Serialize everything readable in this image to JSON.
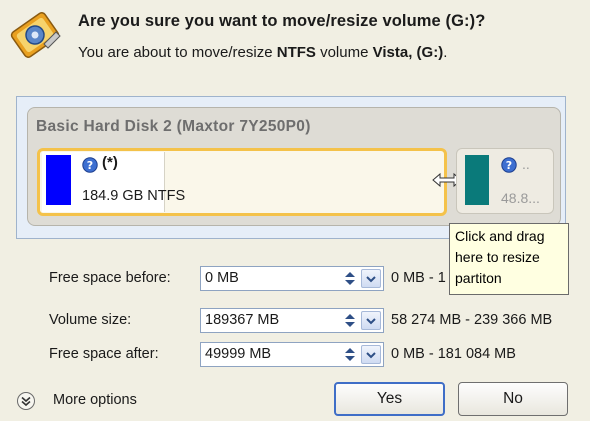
{
  "dialog": {
    "title": "Are you sure you want to move/resize volume (G:)?",
    "subtitle_prefix": "You are about to move/resize ",
    "subtitle_fs": "NTFS",
    "subtitle_mid": " volume ",
    "subtitle_volume": "Vista, (G:)",
    "subtitle_suffix": "."
  },
  "disk": {
    "title": "Basic Hard Disk 2 (Maxtor 7Y250P0)",
    "volumes": [
      {
        "label": "(*)",
        "size": "184.9 GB NTFS",
        "color": "#0000ff"
      },
      {
        "label": "..",
        "size": "48.8...",
        "color": "#0a7a7a"
      }
    ]
  },
  "tooltip": {
    "lines": [
      "Click and drag",
      "here to resize",
      "partiton"
    ]
  },
  "form": {
    "rows": [
      {
        "label": "Free space before:",
        "value": "0 MB",
        "range": "0 MB - 1"
      },
      {
        "label": "Volume size:",
        "value": "189367 MB",
        "range": "58 274 MB - 239 366 MB"
      },
      {
        "label": "Free space after:",
        "value": "49999 MB",
        "range": "0 MB - 181 084 MB"
      }
    ]
  },
  "footer": {
    "more_options": "More options",
    "yes": "Yes",
    "no": "No"
  },
  "icons": {
    "app": "disk-pencil-icon",
    "help": "question-icon",
    "resize": "resize-arrows-icon",
    "spin": "up-down-spinner-icon",
    "dropdown": "chevron-down-icon",
    "more": "double-chevron-down-icon"
  },
  "colors": {
    "selection_border": "#f4c24a",
    "tooltip_bg": "#ffffe1",
    "default_button_border": "#3f6ec7"
  }
}
